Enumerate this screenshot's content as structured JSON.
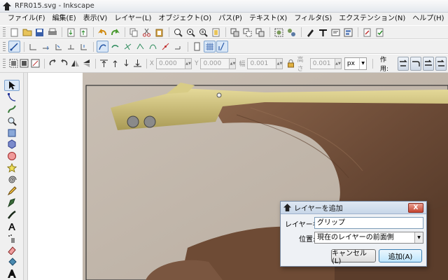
{
  "window": {
    "title": "RFR015.svg - Inkscape"
  },
  "menu": [
    "ファイル(F)",
    "編集(E)",
    "表示(V)",
    "レイヤー(L)",
    "オブジェクト(O)",
    "パス(P)",
    "テキスト(X)",
    "フィルタ(S)",
    "エクステンション(N)",
    "ヘルプ(H)"
  ],
  "coords": {
    "x_label": "X",
    "x_value": "0.000",
    "y_label": "Y",
    "y_value": "0.000",
    "w_label": "幅",
    "w_value": "0.001",
    "h_label": "高さ",
    "h_value": "0.001"
  },
  "unit": "px",
  "affect_label": "作用:",
  "dialog": {
    "title": "レイヤーを追加",
    "name_label": "レイヤー名:",
    "name_value": "グリップ",
    "position_label": "位置:",
    "position_value": "現在のレイヤーの前面側",
    "cancel_label": "キャンセル(L)",
    "add_label": "追加(A)",
    "close_label": "X"
  },
  "colors": {
    "accent": "#3c7fb1",
    "dialog_close": "#c4432f",
    "canvas_wood": "#6b4a36",
    "brass": "#cfc07a"
  }
}
